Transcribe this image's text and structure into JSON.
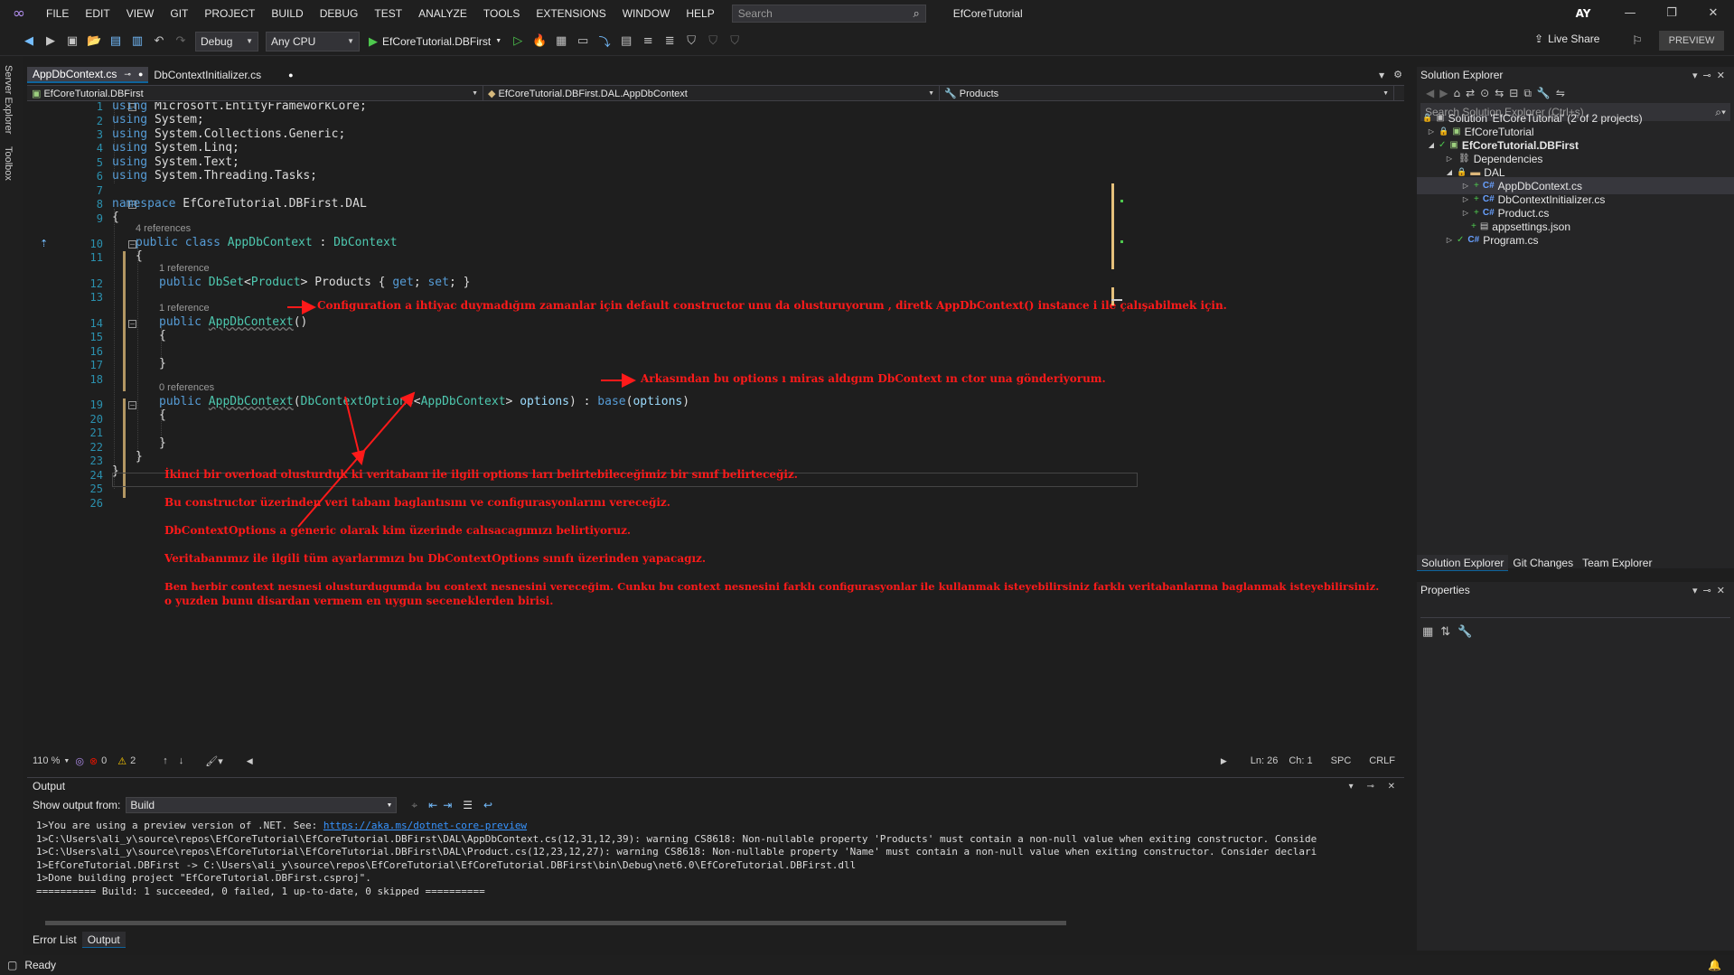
{
  "menubar": {
    "items": [
      "FILE",
      "EDIT",
      "VIEW",
      "GIT",
      "PROJECT",
      "BUILD",
      "DEBUG",
      "TEST",
      "ANALYZE",
      "TOOLS",
      "EXTENSIONS",
      "WINDOW",
      "HELP"
    ],
    "search_placeholder": "Search",
    "app_title": "EfCoreTutorial",
    "avatar_initials": "AY"
  },
  "toolbar": {
    "config": "Debug",
    "platform": "Any CPU",
    "run_target": "EfCoreTutorial.DBFirst",
    "live_share": "Live Share",
    "preview": "PREVIEW"
  },
  "side_tabs": [
    "Server Explorer",
    "Toolbox"
  ],
  "doc_tabs": [
    {
      "label": "AppDbContext.cs",
      "active": true
    },
    {
      "label": "DbContextInitializer.cs",
      "active": false
    }
  ],
  "navbar": {
    "project": "EfCoreTutorial.DBFirst",
    "type": "EfCoreTutorial.DBFirst.DAL.AppDbContext",
    "member": "Products"
  },
  "code": {
    "line_numbers": [
      "1",
      "2",
      "3",
      "4",
      "5",
      "6",
      "7",
      "8",
      "9",
      "10",
      "11",
      "12",
      "13",
      "14",
      "15",
      "16",
      "17",
      "18",
      "19",
      "20",
      "21",
      "22",
      "23",
      "24",
      "25",
      "26"
    ],
    "lens": {
      "class_refs": "4 references",
      "products_refs": "1 reference",
      "ctor1_refs": "1 reference",
      "ctor2_refs": "0 references"
    },
    "u1_ns": "Microsoft.EntityFrameworkCore;",
    "u2_ns": "System;",
    "u3_ns": "System.Collections.Generic;",
    "u4_ns": "System.Linq;",
    "u5_ns": "System.Text;",
    "u6_ns": "System.Threading.Tasks;",
    "ns_name": "EfCoreTutorial.DBFirst.DAL",
    "class_name": "AppDbContext",
    "base_class": "DbContext",
    "dbset_type": "DbSet",
    "entity_type": "Product",
    "prop_name": "Products",
    "ctor_name": "AppDbContext",
    "options_type": "DbContextOptions",
    "options_param": "options",
    "base_kw": "base",
    "kw_using": "using",
    "kw_namespace": "namespace",
    "kw_public": "public",
    "kw_class": "class",
    "kw_get": "get",
    "kw_set": "set"
  },
  "annotations": {
    "default_ctor": "Configuration a ihtiyac duymadığım zamanlar için default constructor unu da olusturuyorum , diretk AppDbContext() instance i ile çalışabilmek için.",
    "options_ctor": "Arkasından bu options ı miras aldıgım DbContext ın ctor una gönderiyorum.",
    "note1": "İkinci bir overload olusturduk ki veritabanı ile ilgili options ları belirtebileceğimiz bir sınıf belirteceğiz.",
    "note2": "Bu constructor üzerinden veri tabanı baglantısını ve configurasyonlarını vereceğiz.",
    "note3": "DbContextOptions a generic olarak kim üzerinde calısacagımızı belirtiyoruz.",
    "note4": "Veritabanımız ile ilgili tüm ayarlarımızı bu DbContextOptions sınıfı üzerinden yapacagız.",
    "note5": "Ben herbir context nesnesi olusturdugumda bu context nesnesini vereceğim. Cunku bu context nesnesini farklı configurasyonlar ile kullanmak isteyebilirsiniz farklı veritabanlarına baglanmak isteyebilirsiniz.",
    "note6": "o yuzden bunu disardan vermem en uygun seceneklerden birisi."
  },
  "editor_status": {
    "zoom": "110 %",
    "errors": "0",
    "warnings": "2",
    "line": "Ln: 26",
    "col": "Ch: 1",
    "spc": "SPC",
    "eol": "CRLF"
  },
  "output": {
    "title": "Output",
    "show_from_label": "Show output from:",
    "source": "Build",
    "lines": [
      "1>You are using a preview version of .NET. See: ",
      "1>C:\\Users\\ali_y\\source\\repos\\EfCoreTutorial\\EfCoreTutorial.DBFirst\\DAL\\AppDbContext.cs(12,31,12,39): warning CS8618: Non-nullable property 'Products' must contain a non-null value when exiting constructor. Conside",
      "1>C:\\Users\\ali_y\\source\\repos\\EfCoreTutorial\\EfCoreTutorial.DBFirst\\DAL\\Product.cs(12,23,12,27): warning CS8618: Non-nullable property 'Name' must contain a non-null value when exiting constructor. Consider declari",
      "1>EfCoreTutorial.DBFirst -> C:\\Users\\ali_y\\source\\repos\\EfCoreTutorial\\EfCoreTutorial.DBFirst\\bin\\Debug\\net6.0\\EfCoreTutorial.DBFirst.dll",
      "1>Done building project \"EfCoreTutorial.DBFirst.csproj\".",
      "========== Build: 1 succeeded, 0 failed, 1 up-to-date, 0 skipped =========="
    ],
    "link": "https://aka.ms/dotnet-core-preview"
  },
  "bottom_tabs": [
    "Error List",
    "Output"
  ],
  "status": {
    "text": "Ready"
  },
  "solution_explorer": {
    "title": "Solution Explorer",
    "search_placeholder": "Search Solution Explorer (Ctrl+ş)",
    "tree": [
      {
        "label": "Solution 'EfCoreTutorial' (2 of 2 projects)"
      },
      {
        "label": "EfCoreTutorial"
      },
      {
        "label": "EfCoreTutorial.DBFirst"
      },
      {
        "label": "Dependencies"
      },
      {
        "label": "DAL"
      },
      {
        "label": "AppDbContext.cs"
      },
      {
        "label": "DbContextInitializer.cs"
      },
      {
        "label": "Product.cs"
      },
      {
        "label": "appsettings.json"
      },
      {
        "label": "Program.cs"
      }
    ],
    "tabs": [
      "Solution Explorer",
      "Git Changes",
      "Team Explorer"
    ]
  },
  "properties": {
    "title": "Properties"
  }
}
